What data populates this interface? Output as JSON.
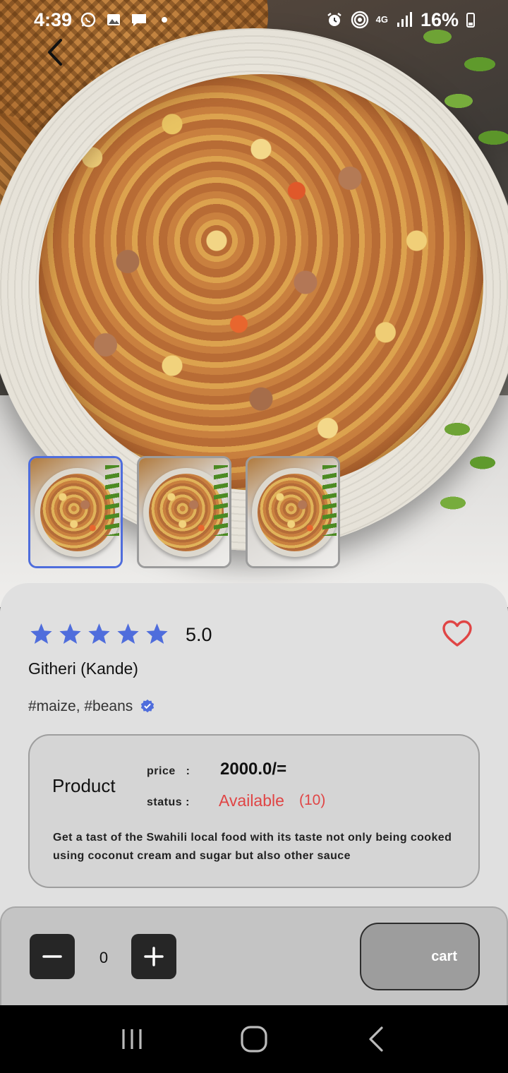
{
  "status_bar": {
    "time": "4:39",
    "battery": "16%",
    "network": "4G",
    "icons": [
      "whatsapp-icon",
      "gallery-icon",
      "message-icon",
      "dot-icon",
      "alarm-icon",
      "hotspot-icon",
      "signal-icon",
      "battery-icon"
    ]
  },
  "header": {
    "back_icon": "chevron-left-icon"
  },
  "gallery": {
    "selected_index": 0,
    "thumbnails": [
      {
        "name": "thumbnail-1",
        "selected": true
      },
      {
        "name": "thumbnail-2",
        "selected": false
      },
      {
        "name": "thumbnail-3",
        "selected": false
      }
    ]
  },
  "product": {
    "rating": 5,
    "rating_max": 5,
    "rating_text": "5.0",
    "name": "Githeri (Kande)",
    "tags": "#maize, #beans",
    "verified_icon": "verified-badge-icon",
    "favorite_icon": "heart-outline-icon",
    "box_title": "Product",
    "price_key": "price   :",
    "price_value": "2000.0/=",
    "status_key": "status :",
    "status_value": "Available",
    "stock": "(10)",
    "description": "Get a tast of the Swahili local food with its taste not only being cooked using coconut cream and sugar but also other sauce"
  },
  "actions": {
    "quantity": "0",
    "minus_icon": "minus-icon",
    "plus_icon": "plus-icon",
    "cart_label": "cart"
  },
  "nav": {
    "icons": [
      "recents-icon",
      "home-icon",
      "back-icon"
    ]
  },
  "colors": {
    "accent_blue": "#4f6ddc",
    "favorite_red": "#e04545",
    "status_red": "#e04545",
    "card_bg": "#e0e0e0",
    "action_bar_bg": "#c4c4c4",
    "cart_bg": "#9d9d9d"
  }
}
